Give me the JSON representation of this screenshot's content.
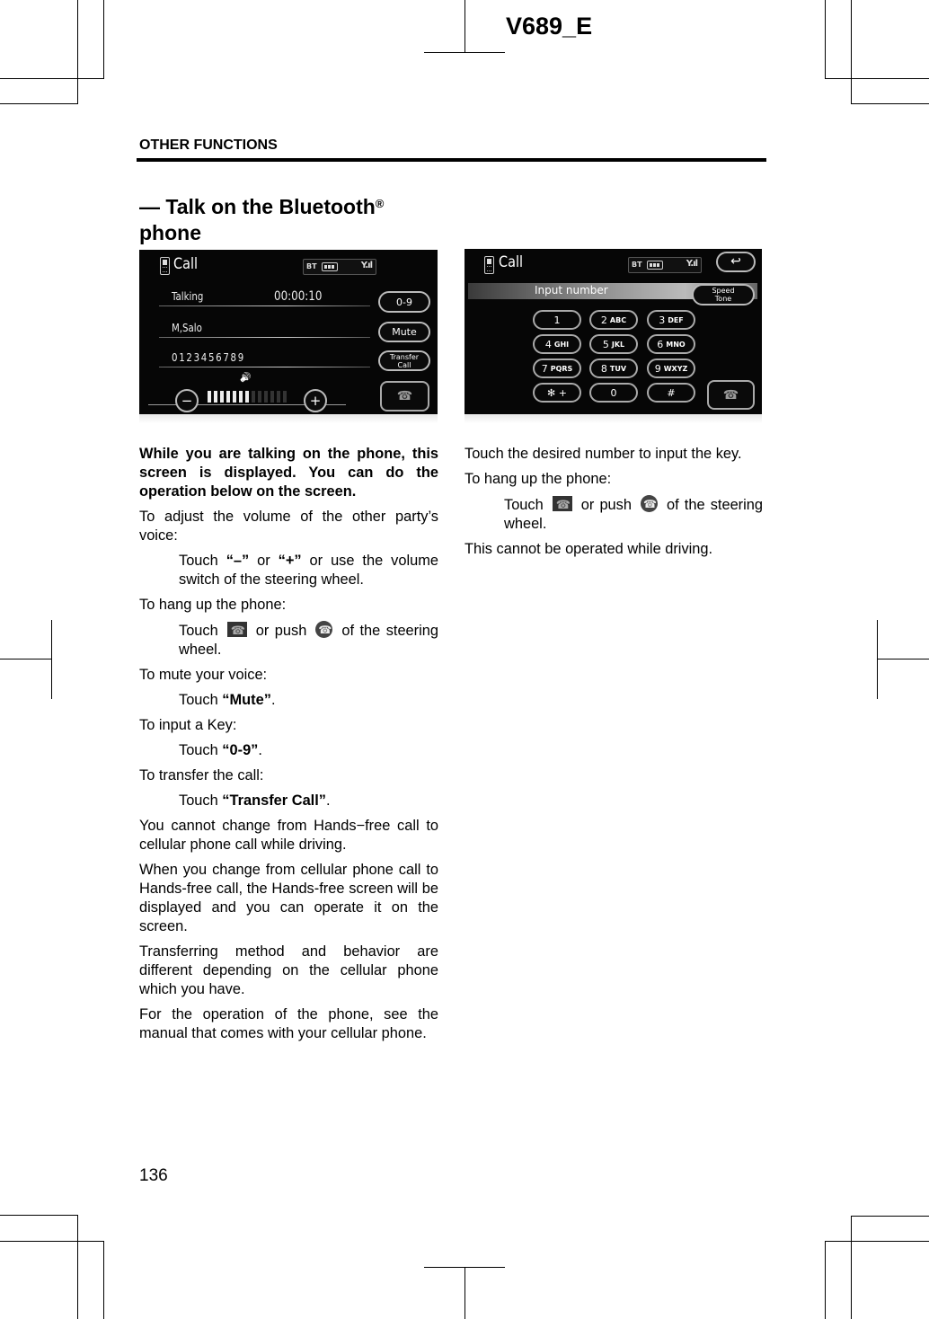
{
  "header": {
    "doc_code": "V689_E",
    "section": "OTHER FUNCTIONS"
  },
  "title": {
    "text": "— Talk on the Bluetooth",
    "reg_mark": "®",
    "text2": "phone"
  },
  "screen_call": {
    "title": "Call",
    "status_bt": "BT",
    "status_signal": "Y.ıl",
    "rows": [
      {
        "label": "Talking",
        "value": "00:00:10"
      },
      {
        "label": "M,Salo",
        "value": ""
      },
      {
        "label": "0123456789",
        "value": ""
      }
    ],
    "buttons": {
      "keypad": "0-9",
      "mute": "Mute",
      "transfer_line1": "Transfer",
      "transfer_line2": "Call",
      "minus": "−",
      "plus": "+",
      "hangup_icon": "☎"
    },
    "volume_icon": "🔊",
    "volume_level": 7,
    "volume_max": 13
  },
  "screen_keypad": {
    "title": "Call",
    "status_bt": "BT",
    "status_signal": "Y.ıl",
    "back_icon": "↩",
    "input_label": "Input number",
    "speed_tone_line1": "Speed",
    "speed_tone_line2": "Tone",
    "keys": [
      {
        "num": "1",
        "letters": ""
      },
      {
        "num": "2",
        "letters": "ABC"
      },
      {
        "num": "3",
        "letters": "DEF"
      },
      {
        "num": "4",
        "letters": "GHI"
      },
      {
        "num": "5",
        "letters": "JKL"
      },
      {
        "num": "6",
        "letters": "MNO"
      },
      {
        "num": "7",
        "letters": "PQRS"
      },
      {
        "num": "8",
        "letters": "TUV"
      },
      {
        "num": "9",
        "letters": "WXYZ"
      },
      {
        "num": "✻  +",
        "letters": ""
      },
      {
        "num": "0",
        "letters": ""
      },
      {
        "num": "#",
        "letters": ""
      }
    ],
    "hangup_icon": "☎"
  },
  "left_text": {
    "lead": "While you are talking on the phone, this screen is displayed.  You can do the operation below on the screen.",
    "volume_intro": "To adjust the volume of the other party’s voice:",
    "volume_touch": "Touch",
    "volume_minus": "“–”",
    "volume_or": " or ",
    "volume_plus": "“+”",
    "volume_rest": " or use the volume switch of the steering wheel.",
    "hangup_intro": "To hang up the phone:",
    "hangup_touch": "Touch",
    "hangup_or_push": "or push",
    "hangup_rest": "of the steering wheel.",
    "mute_intro": "To mute your voice:",
    "mute_touch": "Touch ",
    "mute_label": "“Mute”",
    "key_intro": "To input a Key:",
    "key_touch": "Touch ",
    "key_label": "“0-9”",
    "transfer_intro": "To transfer the call:",
    "transfer_touch": "Touch ",
    "transfer_label": "“Transfer Call”",
    "period": ".",
    "para1": "You cannot change from Hands−free call to cellular phone call while driving.",
    "para2": "When you change from cellular phone call to Hands-free call, the Hands-free screen will be displayed and you can operate it on the screen.",
    "para3": "Transferring method and behavior are different depending on the cellular phone which you have.",
    "para4": "For the operation of the phone, see the manual that comes with your cellular phone."
  },
  "right_text": {
    "para1": "Touch the desired number to input the key.",
    "hangup_intro": "To hang up the phone:",
    "hangup_touch": "Touch",
    "hangup_or_push": "or push",
    "hangup_rest": "of the steering wheel.",
    "para2": "This cannot be operated while driving."
  },
  "footer": {
    "page_number": "136"
  }
}
